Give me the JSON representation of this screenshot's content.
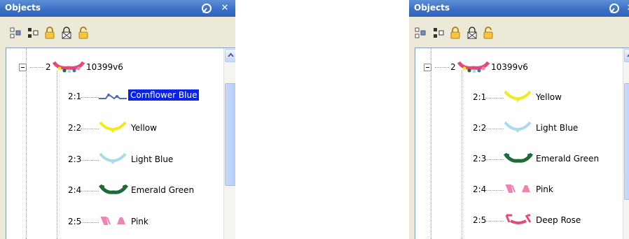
{
  "panels": [
    {
      "title": "Objects",
      "root": {
        "index": "2",
        "name": "10399v6"
      },
      "children": [
        {
          "index": "2:1",
          "name": "Cornflower Blue",
          "selected": true
        },
        {
          "index": "2:2",
          "name": "Yellow",
          "selected": false
        },
        {
          "index": "2:3",
          "name": "Light Blue",
          "selected": false
        },
        {
          "index": "2:4",
          "name": "Emerald Green",
          "selected": false
        },
        {
          "index": "2:5",
          "name": "Pink",
          "selected": false
        }
      ]
    },
    {
      "title": "Objects",
      "root": {
        "index": "2",
        "name": "10399v6"
      },
      "children": [
        {
          "index": "2:1",
          "name": "Yellow",
          "selected": false
        },
        {
          "index": "2:2",
          "name": "Light Blue",
          "selected": false
        },
        {
          "index": "2:3",
          "name": "Emerald Green",
          "selected": false
        },
        {
          "index": "2:4",
          "name": "Pink",
          "selected": false
        },
        {
          "index": "2:5",
          "name": "Deep Rose",
          "selected": false
        }
      ]
    }
  ],
  "toolbar_icons": [
    "group-icon",
    "ungroup-icon",
    "lock-icon",
    "lock-all-icon",
    "unlock-icon"
  ],
  "colors": {
    "title_bar": "#3a6ec5",
    "selection": "#0a24e6",
    "cornflower_blue": "#4a6fb0",
    "yellow": "#f2ea1e",
    "light_blue": "#a9dcea",
    "emerald_green": "#1e6b3a",
    "pink": "#ef83b6",
    "deep_rose": "#e8477a"
  }
}
